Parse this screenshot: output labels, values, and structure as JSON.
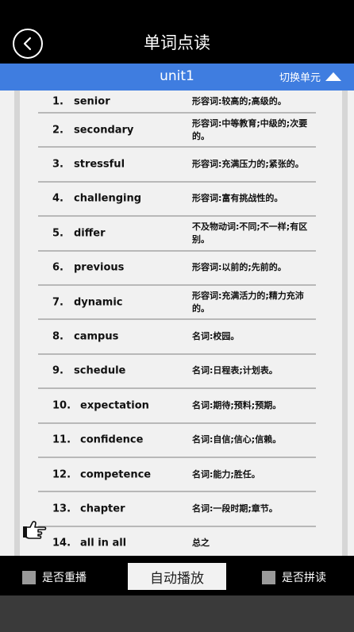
{
  "header": {
    "title": "单词点读"
  },
  "unit_bar": {
    "unit_name": "unit1",
    "switch_label": "切换单元"
  },
  "words": [
    {
      "num": "1.",
      "word": "senior",
      "definition": "形容词:较高的;高级的。"
    },
    {
      "num": "2.",
      "word": "secondary",
      "definition": "形容词:中等教育;中级的;次要的。"
    },
    {
      "num": "3.",
      "word": "stressful",
      "definition": "形容词:充满压力的;紧张的。"
    },
    {
      "num": "4.",
      "word": "challenging",
      "definition": "形容词:富有挑战性的。"
    },
    {
      "num": "5.",
      "word": "differ",
      "definition": "不及物动词:不同;不一样;有区别。"
    },
    {
      "num": "6.",
      "word": "previous",
      "definition": "形容词:以前的;先前的。"
    },
    {
      "num": "7.",
      "word": "dynamic",
      "definition": "形容词:充满活力的;精力充沛的。"
    },
    {
      "num": "8.",
      "word": "campus",
      "definition": "名词:校园。"
    },
    {
      "num": "9.",
      "word": "schedule",
      "definition": "名词:日程表;计划表。"
    },
    {
      "num": "10.",
      "word": "expectation",
      "definition": "名词:期待;预料;预期。"
    },
    {
      "num": "11.",
      "word": "confidence",
      "definition": "名词:自信;信心;信赖。"
    },
    {
      "num": "12.",
      "word": "competence",
      "definition": "名词:能力;胜任。"
    },
    {
      "num": "13.",
      "word": "chapter",
      "definition": "名词:一段时期;章节。"
    },
    {
      "num": "14.",
      "word": "all in all",
      "definition": "总之"
    }
  ],
  "bottom_bar": {
    "repeat_label": "是否重播",
    "auto_play_label": "自动播放",
    "spell_label": "是否拼读"
  },
  "colors": {
    "accent": "#3f7de0",
    "background": "#000000",
    "panel": "#f1f1f1"
  }
}
